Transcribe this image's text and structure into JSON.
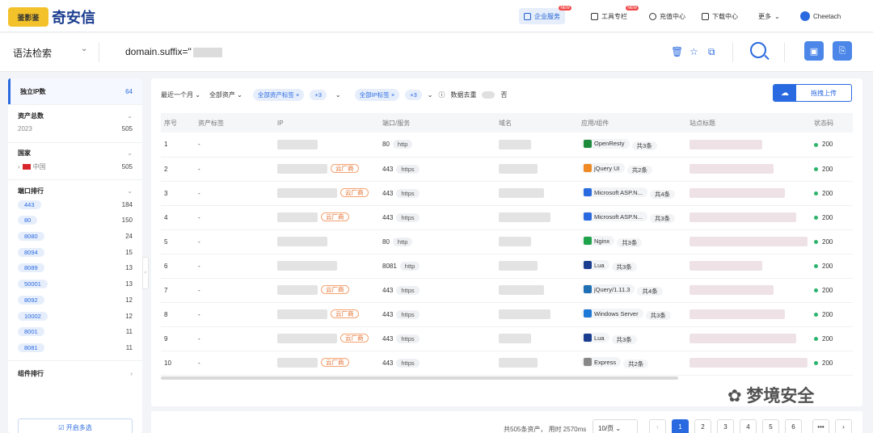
{
  "brand": {
    "logo_mark": "鉴影鉴",
    "name": "奇安信"
  },
  "nav": [
    {
      "label": "企业服务",
      "hot": "NEW",
      "active": true
    },
    {
      "label": "工具专栏",
      "hot": "NEW",
      "active": false
    },
    {
      "label": "充值中心",
      "hot": "",
      "active": false
    },
    {
      "label": "下载中心",
      "hot": "",
      "active": false
    },
    {
      "label": "更多",
      "hot": "",
      "active": false
    },
    {
      "label": "Cheetach",
      "hot": "",
      "active": false
    }
  ],
  "search": {
    "syntax_label": "语法检索",
    "query": "domain.suffix=\""
  },
  "sidebar": {
    "unique_ip": {
      "label": "独立IP数",
      "value": "64"
    },
    "assets": {
      "label": "资产总数",
      "rows": [
        {
          "name": "2023",
          "count": "505"
        }
      ]
    },
    "country": {
      "label": "国家",
      "rows": [
        {
          "name": "中国",
          "count": "505"
        }
      ]
    },
    "ports": {
      "label": "端口排行",
      "rows": [
        {
          "name": "443",
          "count": "184"
        },
        {
          "name": "80",
          "count": "150"
        },
        {
          "name": "8080",
          "count": "24"
        },
        {
          "name": "8094",
          "count": "15"
        },
        {
          "name": "8089",
          "count": "13"
        },
        {
          "name": "50001",
          "count": "13"
        },
        {
          "name": "8092",
          "count": "12"
        },
        {
          "name": "10002",
          "count": "12"
        },
        {
          "name": "8001",
          "count": "11"
        },
        {
          "name": "8081",
          "count": "11"
        }
      ]
    },
    "components_label": "组件排行",
    "multi_select": "开启多选"
  },
  "filters": {
    "time": "最近一个月",
    "asset": "全部资产",
    "asset_tag": "全部资产标签",
    "asset_tag_more": "+3",
    "ip_tag": "全部IP标签",
    "ip_tag_more": "+3",
    "dedup_label": "数据去重",
    "dedup_value": "否",
    "upload": "拖拽上传"
  },
  "table": {
    "headers": [
      "序号",
      "资产标签",
      "IP",
      "端口/服务",
      "域名",
      "应用/组件",
      "站点标题",
      "状态码"
    ],
    "rows": [
      {
        "no": "1",
        "tag": "-",
        "cloud": "",
        "port": "80",
        "proto": "http",
        "comp": "OpenResty",
        "comp_color": "#1b8a3a",
        "more": "共3条",
        "status": "200"
      },
      {
        "no": "2",
        "tag": "-",
        "cloud": "云厂商",
        "port": "443",
        "proto": "https",
        "comp": "jQuery UI",
        "comp_color": "#f08a24",
        "more": "共2条",
        "status": "200"
      },
      {
        "no": "3",
        "tag": "-",
        "cloud": "云厂商",
        "port": "443",
        "proto": "https",
        "comp": "Microsoft ASP.N...",
        "comp_color": "#2a6ae0",
        "more": "共4条",
        "status": "200"
      },
      {
        "no": "4",
        "tag": "-",
        "cloud": "云厂商",
        "port": "443",
        "proto": "https",
        "comp": "Microsoft ASP.N...",
        "comp_color": "#2a6ae0",
        "more": "共3条",
        "status": "200"
      },
      {
        "no": "5",
        "tag": "-",
        "cloud": "",
        "port": "80",
        "proto": "http",
        "comp": "Nginx",
        "comp_color": "#1ea34a",
        "more": "共3条",
        "status": "200"
      },
      {
        "no": "6",
        "tag": "-",
        "cloud": "",
        "port": "8081",
        "proto": "http",
        "comp": "Lua",
        "comp_color": "#1a3d8f",
        "more": "共3条",
        "status": "200"
      },
      {
        "no": "7",
        "tag": "-",
        "cloud": "云厂商",
        "port": "443",
        "proto": "https",
        "comp": "jQuery/1.11.3",
        "comp_color": "#1f6fb5",
        "more": "共4条",
        "status": "200"
      },
      {
        "no": "8",
        "tag": "-",
        "cloud": "云厂商",
        "port": "443",
        "proto": "https",
        "comp": "Windows Server",
        "comp_color": "#1e78d6",
        "more": "共3条",
        "status": "200"
      },
      {
        "no": "9",
        "tag": "-",
        "cloud": "云厂商",
        "port": "443",
        "proto": "https",
        "comp": "Lua",
        "comp_color": "#1a3d8f",
        "more": "共3条",
        "status": "200"
      },
      {
        "no": "10",
        "tag": "-",
        "cloud": "云厂商",
        "port": "443",
        "proto": "https",
        "comp": "Express",
        "comp_color": "#888888",
        "more": "共2条",
        "status": "200"
      }
    ]
  },
  "pagination": {
    "summary": "共505条资产，  用时 2570ms",
    "page_size": "10/页",
    "pages": [
      "1",
      "2",
      "3",
      "4",
      "5",
      "6",
      "•••"
    ],
    "current": "1"
  },
  "watermark": "梦境安全"
}
